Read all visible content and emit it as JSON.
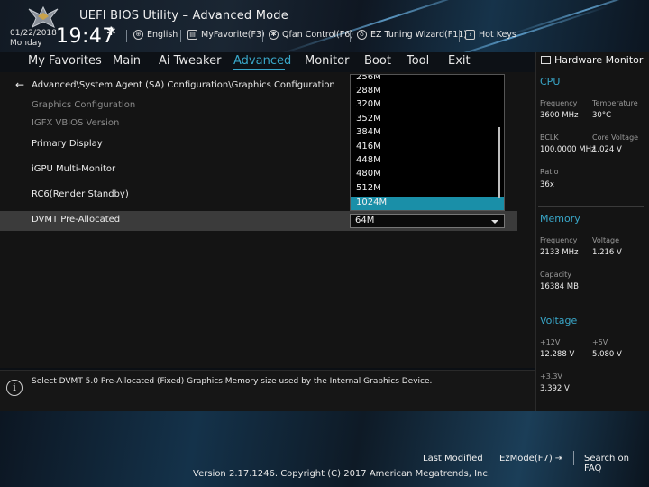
{
  "header": {
    "title": "UEFI BIOS Utility – Advanced Mode",
    "date": "01/22/2018",
    "day": "Monday",
    "time": "19:47",
    "tools": [
      {
        "label": "English",
        "icon": "globe-icon"
      },
      {
        "label": "MyFavorite(F3)",
        "icon": "favorite-icon"
      },
      {
        "label": "Qfan Control(F6)",
        "icon": "fan-icon"
      },
      {
        "label": "EZ Tuning Wizard(F11)",
        "icon": "lightbulb-icon"
      },
      {
        "label": "Hot Keys",
        "icon": "hotkeys-icon"
      }
    ]
  },
  "menu": {
    "items": [
      "My Favorites",
      "Main",
      "Ai Tweaker",
      "Advanced",
      "Monitor",
      "Boot",
      "Tool",
      "Exit"
    ],
    "active": "Advanced"
  },
  "main": {
    "breadcrumb": "Advanced\\System Agent (SA) Configuration\\Graphics Configuration",
    "rows": [
      {
        "label": "Graphics Configuration",
        "style": "dim"
      },
      {
        "label": "IGFX VBIOS Version",
        "style": "dim"
      },
      {
        "label": "Primary Display",
        "style": "bright"
      },
      {
        "label": "iGPU Multi-Monitor",
        "style": "bright"
      },
      {
        "label": "RC6(Render Standby)",
        "style": "bright"
      },
      {
        "label": "DVMT Pre-Allocated",
        "style": "selected"
      }
    ],
    "dropdown_options": [
      "256M",
      "288M",
      "320M",
      "352M",
      "384M",
      "416M",
      "448M",
      "480M",
      "512M",
      "1024M"
    ],
    "dropdown_highlighted": "1024M",
    "selected_value": "64M"
  },
  "info": {
    "text": "Select DVMT 5.0 Pre-Allocated (Fixed) Graphics Memory size used by the Internal Graphics Device."
  },
  "hardware_monitor": {
    "title": "Hardware Monitor",
    "cpu": {
      "heading": "CPU",
      "frequency_label": "Frequency",
      "frequency": "3600 MHz",
      "temperature_label": "Temperature",
      "temperature": "30°C",
      "bclk_label": "BCLK",
      "bclk": "100.0000 MHz",
      "core_voltage_label": "Core Voltage",
      "core_voltage": "1.024 V",
      "ratio_label": "Ratio",
      "ratio": "36x"
    },
    "memory": {
      "heading": "Memory",
      "frequency_label": "Frequency",
      "frequency": "2133 MHz",
      "voltage_label": "Voltage",
      "voltage": "1.216 V",
      "capacity_label": "Capacity",
      "capacity": "16384 MB"
    },
    "voltage": {
      "heading": "Voltage",
      "v12_label": "+12V",
      "v12": "12.288 V",
      "v5_label": "+5V",
      "v5": "5.080 V",
      "v33_label": "+3.3V",
      "v33": "3.392 V"
    }
  },
  "footer": {
    "last_modified": "Last Modified",
    "ezmode": "EzMode(F7)",
    "search": "Search on FAQ",
    "copyright": "Version 2.17.1246. Copyright (C) 2017 American Megatrends, Inc."
  },
  "colors": {
    "accent": "#39a7c9",
    "highlight": "#1a8fa8",
    "selected_row": "#3b3b3b"
  }
}
